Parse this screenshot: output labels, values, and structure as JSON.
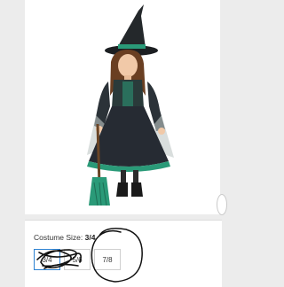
{
  "product": {
    "image_icon": "witch-costume-photo"
  },
  "size_selector": {
    "label": "Costume Size:",
    "selected_value": "3/4",
    "options": [
      "3/4",
      "5/6",
      "7/8"
    ]
  },
  "annotations": {
    "scribble_icon": "pen-scribble",
    "circle_icon": "pen-circle"
  },
  "colors": {
    "selected_border": "#2d82d2",
    "annotation_ink": "#111111",
    "costume_teal": "#2a9a78"
  }
}
